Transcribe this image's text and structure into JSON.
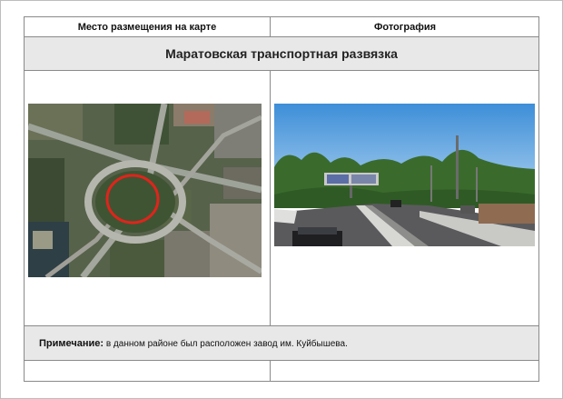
{
  "table": {
    "col_left_header": "Место размещения на карте",
    "col_right_header": "Фотография",
    "title": "Маратовская транспортная развязка",
    "note_label": "Примечание:",
    "note_text": "в данном районе был расположен завод им. Куйбышева."
  },
  "map": {
    "icon": "satellite-map-image",
    "marker_color": "#e0241b"
  },
  "photo": {
    "icon": "road-interchange-photo"
  }
}
